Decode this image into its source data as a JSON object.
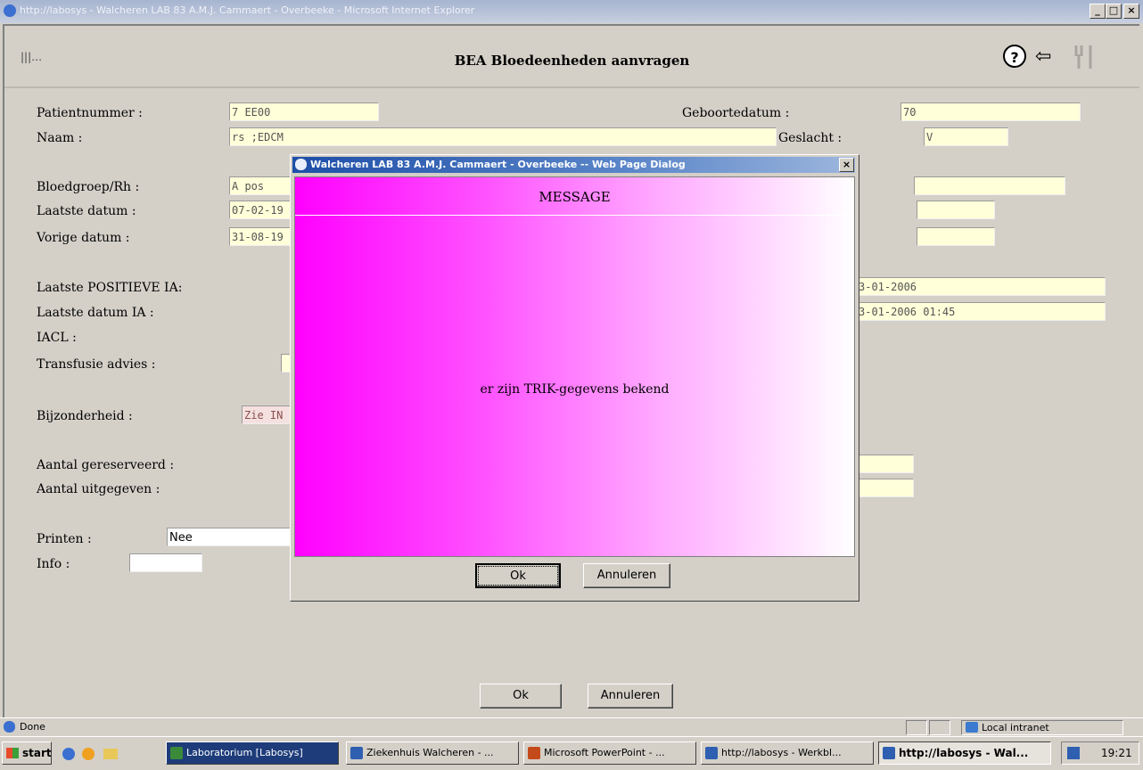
{
  "window": {
    "title": "http://labosys - Walcheren LAB 83 A.M.J. Cammaert - Overbeeke - Microsoft Internet Explorer",
    "minimize": "_",
    "maximize": "□",
    "close": "×"
  },
  "header": {
    "title": "BEA Bloedeenheden aanvragen",
    "logo": "|||…",
    "help_icon": "?",
    "back_icon": "⇦",
    "fork_icon": "🍴"
  },
  "form": {
    "patientnummer": {
      "label": "Patientnummer :",
      "value": "7    EE00"
    },
    "geboortedatum": {
      "label": "Geboortedatum :",
      "value": "      70"
    },
    "naam": {
      "label": "Naam :",
      "value": "       rs ;EDCM"
    },
    "geslacht": {
      "label": "Geslacht :",
      "value": "  V"
    },
    "bloedgroep": {
      "label": "Bloedgroep/Rh :",
      "value": "A pos"
    },
    "laatste_datum": {
      "label": "Laatste datum :",
      "value": "07-02-19"
    },
    "vorige_datum": {
      "label": "Vorige datum :",
      "value": "31-08-19"
    },
    "laatste_positieve_ia": {
      "label": "Laatste POSITIEVE IA:",
      "value": "3-01-2006"
    },
    "laatste_datum_ia": {
      "label": "Laatste datum IA :",
      "value": "3-01-2006 01:45"
    },
    "iacl": {
      "label": "IACL :"
    },
    "transfusie_advies": {
      "label": "Transfusie advies :"
    },
    "bijzonderheid": {
      "label": "Bijzonderheid :",
      "value": "Zie IN"
    },
    "aantal_gereserveerd": {
      "label": "Aantal gereserveerd :"
    },
    "aantal_uitgegeven": {
      "label": "Aantal uitgegeven :"
    },
    "printen": {
      "label": "Printen :",
      "value": "Nee"
    },
    "info": {
      "label": "Info :",
      "value": ""
    }
  },
  "buttons": {
    "ok": "Ok",
    "annuleren": "Annuleren"
  },
  "dialog": {
    "title": "Walcheren LAB 83 A.M.J. Cammaert - Overbeeke -- Web Page Dialog",
    "close": "×",
    "header": "MESSAGE",
    "message": "er zijn TRIK-gegevens bekend",
    "ok": "Ok",
    "annuleren": "Annuleren"
  },
  "statusbar": {
    "left": "Done",
    "zone": "Local intranet"
  },
  "taskbar": {
    "start": "start",
    "tasks": [
      {
        "label": "Laboratorium [Labosys]",
        "color": "#3a8a3a"
      },
      {
        "label": "Ziekenhuis Walcheren - ...",
        "color": "#2f5fb0"
      },
      {
        "label": "Microsoft PowerPoint - ...",
        "color": "#c44a1a"
      },
      {
        "label": "http://labosys - Werkbl...",
        "color": "#2f5fb0"
      },
      {
        "label": "http://labosys - Wal...",
        "color": "#2f5fb0"
      }
    ],
    "clock": "19:21"
  }
}
